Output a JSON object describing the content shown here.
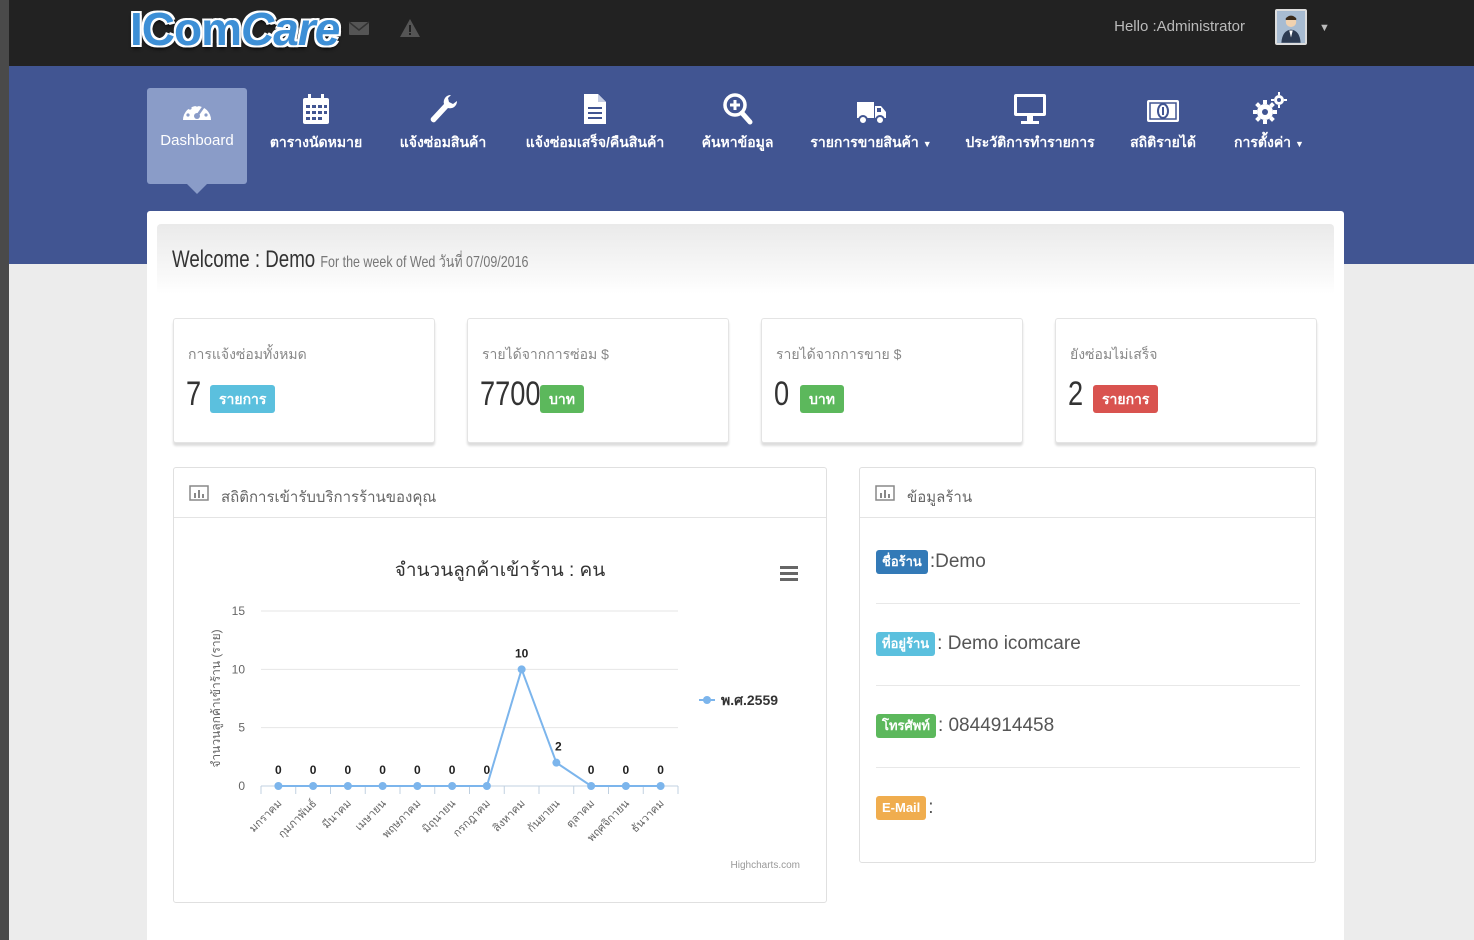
{
  "app": {
    "logo_part1": "ICom",
    "logo_part2": "Care"
  },
  "topbar": {
    "greeting": "Hello :Administrator",
    "icons": [
      "envelope-icon",
      "warning-icon"
    ]
  },
  "nav": {
    "items": [
      {
        "label": "Dashboard",
        "icon": "dashboard-icon",
        "active": true
      },
      {
        "label": "ตารางนัดหมาย",
        "icon": "calendar-icon"
      },
      {
        "label": "แจ้งซ่อมสินค้า",
        "icon": "wrench-icon"
      },
      {
        "label": "แจ้งซ่อมเสร็จ/คืนสินค้า",
        "icon": "document-icon"
      },
      {
        "label": "ค้นหาข้อมูล",
        "icon": "zoom-icon"
      },
      {
        "label": "รายการขายสินค้า",
        "icon": "truck-icon",
        "dropdown": true
      },
      {
        "label": "ประวัติการทำรายการ",
        "icon": "monitor-icon"
      },
      {
        "label": "สถิติรายได้",
        "icon": "money-icon"
      },
      {
        "label": "การตั้งค่า",
        "icon": "gears-icon",
        "dropdown": true
      }
    ]
  },
  "welcome": {
    "title": "Welcome : Demo",
    "subtitle": "For the week of Wed วันที่ 07/09/2016"
  },
  "stats": [
    {
      "title": "การแจ้งซ่อมทั้งหมด",
      "value": "7",
      "badge": "รายการ",
      "color": "#5bc0de"
    },
    {
      "title": "รายได้จากการซ่อม $",
      "value": "7700",
      "badge": "บาท",
      "color": "#5cb85c"
    },
    {
      "title": "รายได้จากการขาย $",
      "value": "0",
      "badge": "บาท",
      "color": "#5cb85c"
    },
    {
      "title": "ยังซ่อมไม่เสร็จ",
      "value": "2",
      "badge": "รายการ",
      "color": "#d9534f"
    }
  ],
  "chart_panel": {
    "title": "สถิติการเข้ารับบริการร้านของคุณ"
  },
  "chart_data": {
    "type": "line",
    "title": "จำนวนลูกค้าเข้าร้าน : คน",
    "ylabel": "จำนวนลูกค้าเข้าร้าน (ราย)",
    "xlabel": "",
    "categories": [
      "มกราคม",
      "กุมภาพันธ์",
      "มีนาคม",
      "เมษายน",
      "พฤษภาคม",
      "มิถุนายน",
      "กรกฎาคม",
      "สิงหาคม",
      "กันยายน",
      "ตุลาคม",
      "พฤศจิกายน",
      "ธันวาคม"
    ],
    "series": [
      {
        "name": "พ.ศ.2559",
        "values": [
          0,
          0,
          0,
          0,
          0,
          0,
          0,
          10,
          2,
          0,
          0,
          0
        ],
        "color": "#7cb5ec"
      }
    ],
    "yticks": [
      "0",
      "5",
      "10",
      "15"
    ],
    "ylim": [
      0,
      15
    ],
    "legend": "right",
    "credits": "Highcharts.com",
    "grid": true
  },
  "shop_panel": {
    "title": "ข้อมูลร้าน",
    "rows": [
      {
        "badge": "ชื่อร้าน",
        "value": ":Demo",
        "color": "#337ab7"
      },
      {
        "badge": "ที่อยู่ร้าน",
        "value": ": Demo icomcare",
        "color": "#5bc0de"
      },
      {
        "badge": "โทรศัพท์",
        "value": ": 0844914458",
        "color": "#5cb85c"
      },
      {
        "badge": "E-Mail",
        "value": ":",
        "color": "#f0ad4e"
      }
    ]
  }
}
